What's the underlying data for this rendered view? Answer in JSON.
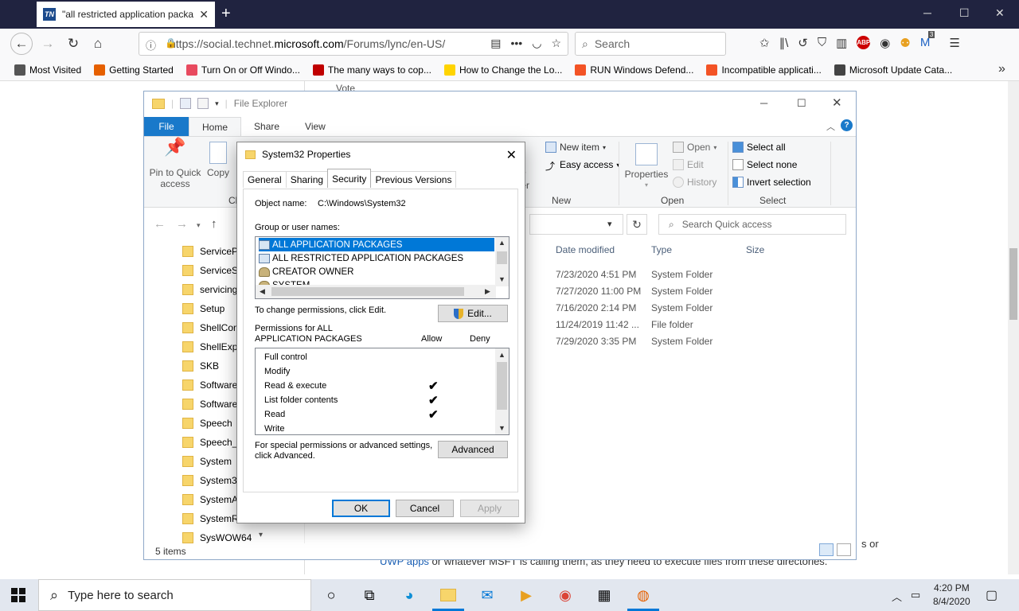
{
  "browser": {
    "tab_title": "\"all restricted application packa",
    "tab_favicon": "TN",
    "url_prefix": "https://social.technet.",
    "url_domain": "microsoft.com",
    "url_suffix": "/Forums/lync/en-US/",
    "search_placeholder": "Search",
    "addon_badge": "3",
    "bookmarks": [
      {
        "label": "Most Visited",
        "icon": "gear-icon",
        "color": "#555555"
      },
      {
        "label": "Getting Started",
        "icon": "firefox-icon",
        "color": "#e66000"
      },
      {
        "label": "Turn On or Off Windo...",
        "icon": "dots-icon",
        "color": "#e84a5f"
      },
      {
        "label": "The many ways to cop...",
        "icon": "power-icon",
        "color": "#c00000"
      },
      {
        "label": "How to Change the Lo...",
        "icon": "d-icon",
        "color": "#ffd400"
      },
      {
        "label": "RUN Windows Defend...",
        "icon": "windows-icon",
        "color": "#f35325"
      },
      {
        "label": "Incompatible applicati...",
        "icon": "windows-icon",
        "color": "#f35325"
      },
      {
        "label": "Microsoft Update Cata...",
        "icon": "globe-icon",
        "color": "#444444"
      }
    ]
  },
  "page": {
    "vote": "Vote",
    "text1": "s or",
    "text2_link1": "UWP",
    "text2_link2": "apps",
    "text2_rest": " or whatever MSFT is calling them,  as they need to execute files from these directories."
  },
  "explorer": {
    "title": "File Explorer",
    "tabs": {
      "file": "File",
      "home": "Home",
      "share": "Share",
      "view": "View"
    },
    "ribbon": {
      "pin": "Pin to Quick access",
      "copy": "Copy",
      "clip_partial": "Cli",
      "new_folder_partial": "ew\nlder",
      "new_item": "New item",
      "easy_access": "Easy access",
      "new_group": "New",
      "properties": "Properties",
      "open": "Open",
      "edit": "Edit",
      "history": "History",
      "open_group": "Open",
      "select_all": "Select all",
      "select_none": "Select none",
      "invert_selection": "Invert selection",
      "select_group": "Select"
    },
    "search_placeholder": "Search Quick access",
    "tree": [
      "ServicePr",
      "ServiceSta",
      "servicing",
      "Setup",
      "ShellCom",
      "ShellExpe",
      "SKB",
      "SoftwareD",
      "SoftwareD",
      "Speech",
      "Speech_O",
      "System",
      "System32",
      "SystemAp",
      "SystemRe",
      "SysWOW64"
    ],
    "columns": {
      "date": "Date modified",
      "type": "Type",
      "size": "Size"
    },
    "rows": [
      {
        "date": "7/23/2020 4:51 PM",
        "type": "System Folder"
      },
      {
        "date": "7/27/2020 11:00 PM",
        "type": "System Folder"
      },
      {
        "date": "7/16/2020 2:14 PM",
        "type": "System Folder"
      },
      {
        "date": "11/24/2019 11:42 ...",
        "type": "File folder"
      },
      {
        "date": "7/29/2020 3:35 PM",
        "type": "System Folder"
      }
    ],
    "status": "5 items"
  },
  "dialog": {
    "title": "System32 Properties",
    "tabs": [
      "General",
      "Sharing",
      "Security",
      "Previous Versions"
    ],
    "active_tab": "Security",
    "object_label": "Object name:",
    "object_value": "C:\\Windows\\System32",
    "group_label": "Group or user names:",
    "users": [
      "ALL APPLICATION PACKAGES",
      "ALL RESTRICTED APPLICATION PACKAGES",
      "CREATOR OWNER",
      "SYSTEM"
    ],
    "selected_user": "ALL APPLICATION PACKAGES",
    "change_text": "To change permissions, click Edit.",
    "edit_button": "Edit...",
    "perm_for_line1": "Permissions for ALL",
    "perm_for_line2": "APPLICATION PACKAGES",
    "allow": "Allow",
    "deny": "Deny",
    "permissions": [
      {
        "name": "Full control",
        "allow": false,
        "deny": false
      },
      {
        "name": "Modify",
        "allow": false,
        "deny": false
      },
      {
        "name": "Read & execute",
        "allow": true,
        "deny": false
      },
      {
        "name": "List folder contents",
        "allow": true,
        "deny": false
      },
      {
        "name": "Read",
        "allow": true,
        "deny": false
      },
      {
        "name": "Write",
        "allow": false,
        "deny": false
      }
    ],
    "check_glyph": "✔",
    "advanced_text_line1": "For special permissions or advanced settings,",
    "advanced_text_line2": "click Advanced.",
    "advanced_button": "Advanced",
    "ok": "OK",
    "cancel": "Cancel",
    "apply": "Apply"
  },
  "taskbar": {
    "search_placeholder": "Type here to search",
    "time": "4:20 PM",
    "date": "8/4/2020"
  },
  "colors": {
    "accent": "#0078d7",
    "file_tab": "#1979ca",
    "browser_frame": "#202340"
  }
}
